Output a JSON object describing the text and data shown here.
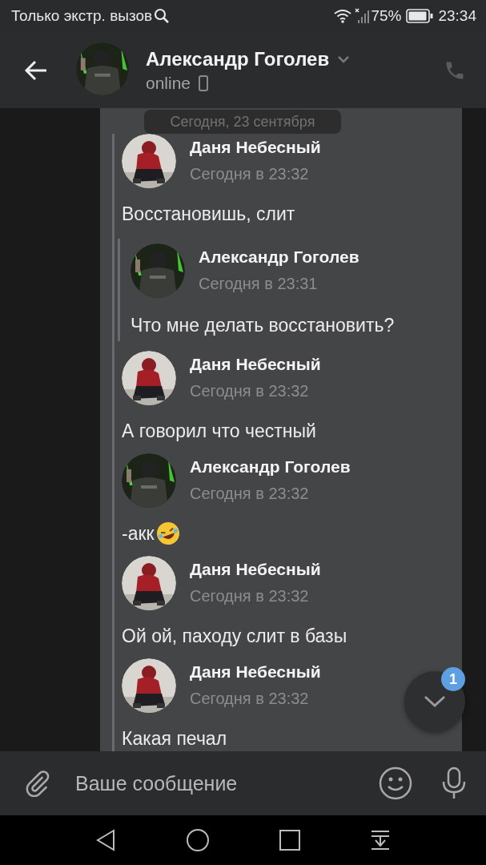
{
  "status_bar": {
    "carrier": "Только экстр. вызов",
    "battery": "75%",
    "time": "23:34"
  },
  "header": {
    "name": "Александр Гоголев",
    "status": "online"
  },
  "date_pill": "Сегодня, 23 сентября",
  "messages": [
    {
      "author": "Даня Небесный",
      "time": "Сегодня в 23:32",
      "kind": "hoodie",
      "text": "Восстановишь, слит",
      "quote": {
        "author": "Александр Гоголев",
        "time": "Сегодня в 23:31",
        "kind": "mask",
        "text": "Что мне делать восстановить?"
      }
    },
    {
      "author": "Даня Небесный",
      "time": "Сегодня в 23:32",
      "kind": "hoodie",
      "text": "А говорил что честный"
    },
    {
      "author": "Александр Гоголев",
      "time": "Сегодня в 23:32",
      "kind": "mask",
      "text": "-акк",
      "emoji": true
    },
    {
      "author": "Даня Небесный",
      "time": "Сегодня в 23:32",
      "kind": "hoodie",
      "text": "Ой ой, паходу слит в базы"
    },
    {
      "author": "Даня Небесный",
      "time": "Сегодня в 23:32",
      "kind": "hoodie",
      "text": "Какая печал"
    }
  ],
  "composer": {
    "placeholder": "Ваше сообщение"
  },
  "scroll_button": {
    "badge": "1"
  }
}
